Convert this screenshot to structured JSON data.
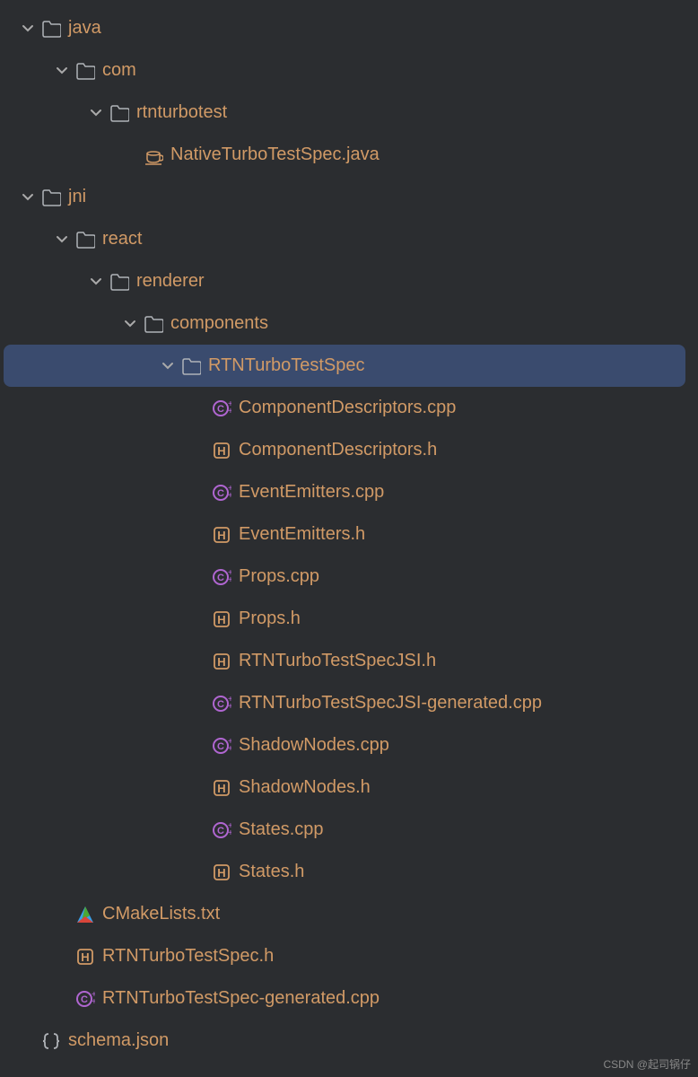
{
  "watermark": "CSDN @起司锅仔",
  "tree": [
    {
      "depth": 0,
      "type": "folder",
      "expanded": true,
      "label": "java"
    },
    {
      "depth": 1,
      "type": "folder",
      "expanded": true,
      "label": "com"
    },
    {
      "depth": 2,
      "type": "folder",
      "expanded": true,
      "label": "rtnturbotest"
    },
    {
      "depth": 3,
      "type": "java",
      "label": "NativeTurboTestSpec.java"
    },
    {
      "depth": 0,
      "type": "folder",
      "expanded": true,
      "label": "jni"
    },
    {
      "depth": 1,
      "type": "folder",
      "expanded": true,
      "label": "react"
    },
    {
      "depth": 2,
      "type": "folder",
      "expanded": true,
      "label": "renderer"
    },
    {
      "depth": 3,
      "type": "folder",
      "expanded": true,
      "label": "components"
    },
    {
      "depth": 4,
      "type": "folder",
      "expanded": true,
      "label": "RTNTurboTestSpec",
      "selected": true
    },
    {
      "depth": 5,
      "type": "cpp",
      "label": "ComponentDescriptors.cpp"
    },
    {
      "depth": 5,
      "type": "h",
      "label": "ComponentDescriptors.h"
    },
    {
      "depth": 5,
      "type": "cpp",
      "label": "EventEmitters.cpp"
    },
    {
      "depth": 5,
      "type": "h",
      "label": "EventEmitters.h"
    },
    {
      "depth": 5,
      "type": "cpp",
      "label": "Props.cpp"
    },
    {
      "depth": 5,
      "type": "h",
      "label": "Props.h"
    },
    {
      "depth": 5,
      "type": "h",
      "label": "RTNTurboTestSpecJSI.h"
    },
    {
      "depth": 5,
      "type": "cpp",
      "label": "RTNTurboTestSpecJSI-generated.cpp"
    },
    {
      "depth": 5,
      "type": "cpp",
      "label": "ShadowNodes.cpp"
    },
    {
      "depth": 5,
      "type": "h",
      "label": "ShadowNodes.h"
    },
    {
      "depth": 5,
      "type": "cpp",
      "label": "States.cpp"
    },
    {
      "depth": 5,
      "type": "h",
      "label": "States.h"
    },
    {
      "depth": 1,
      "type": "cmake",
      "label": "CMakeLists.txt"
    },
    {
      "depth": 1,
      "type": "h",
      "label": "RTNTurboTestSpec.h"
    },
    {
      "depth": 1,
      "type": "cpp",
      "label": "RTNTurboTestSpec-generated.cpp"
    },
    {
      "depth": 0,
      "type": "json",
      "label": "schema.json"
    }
  ]
}
